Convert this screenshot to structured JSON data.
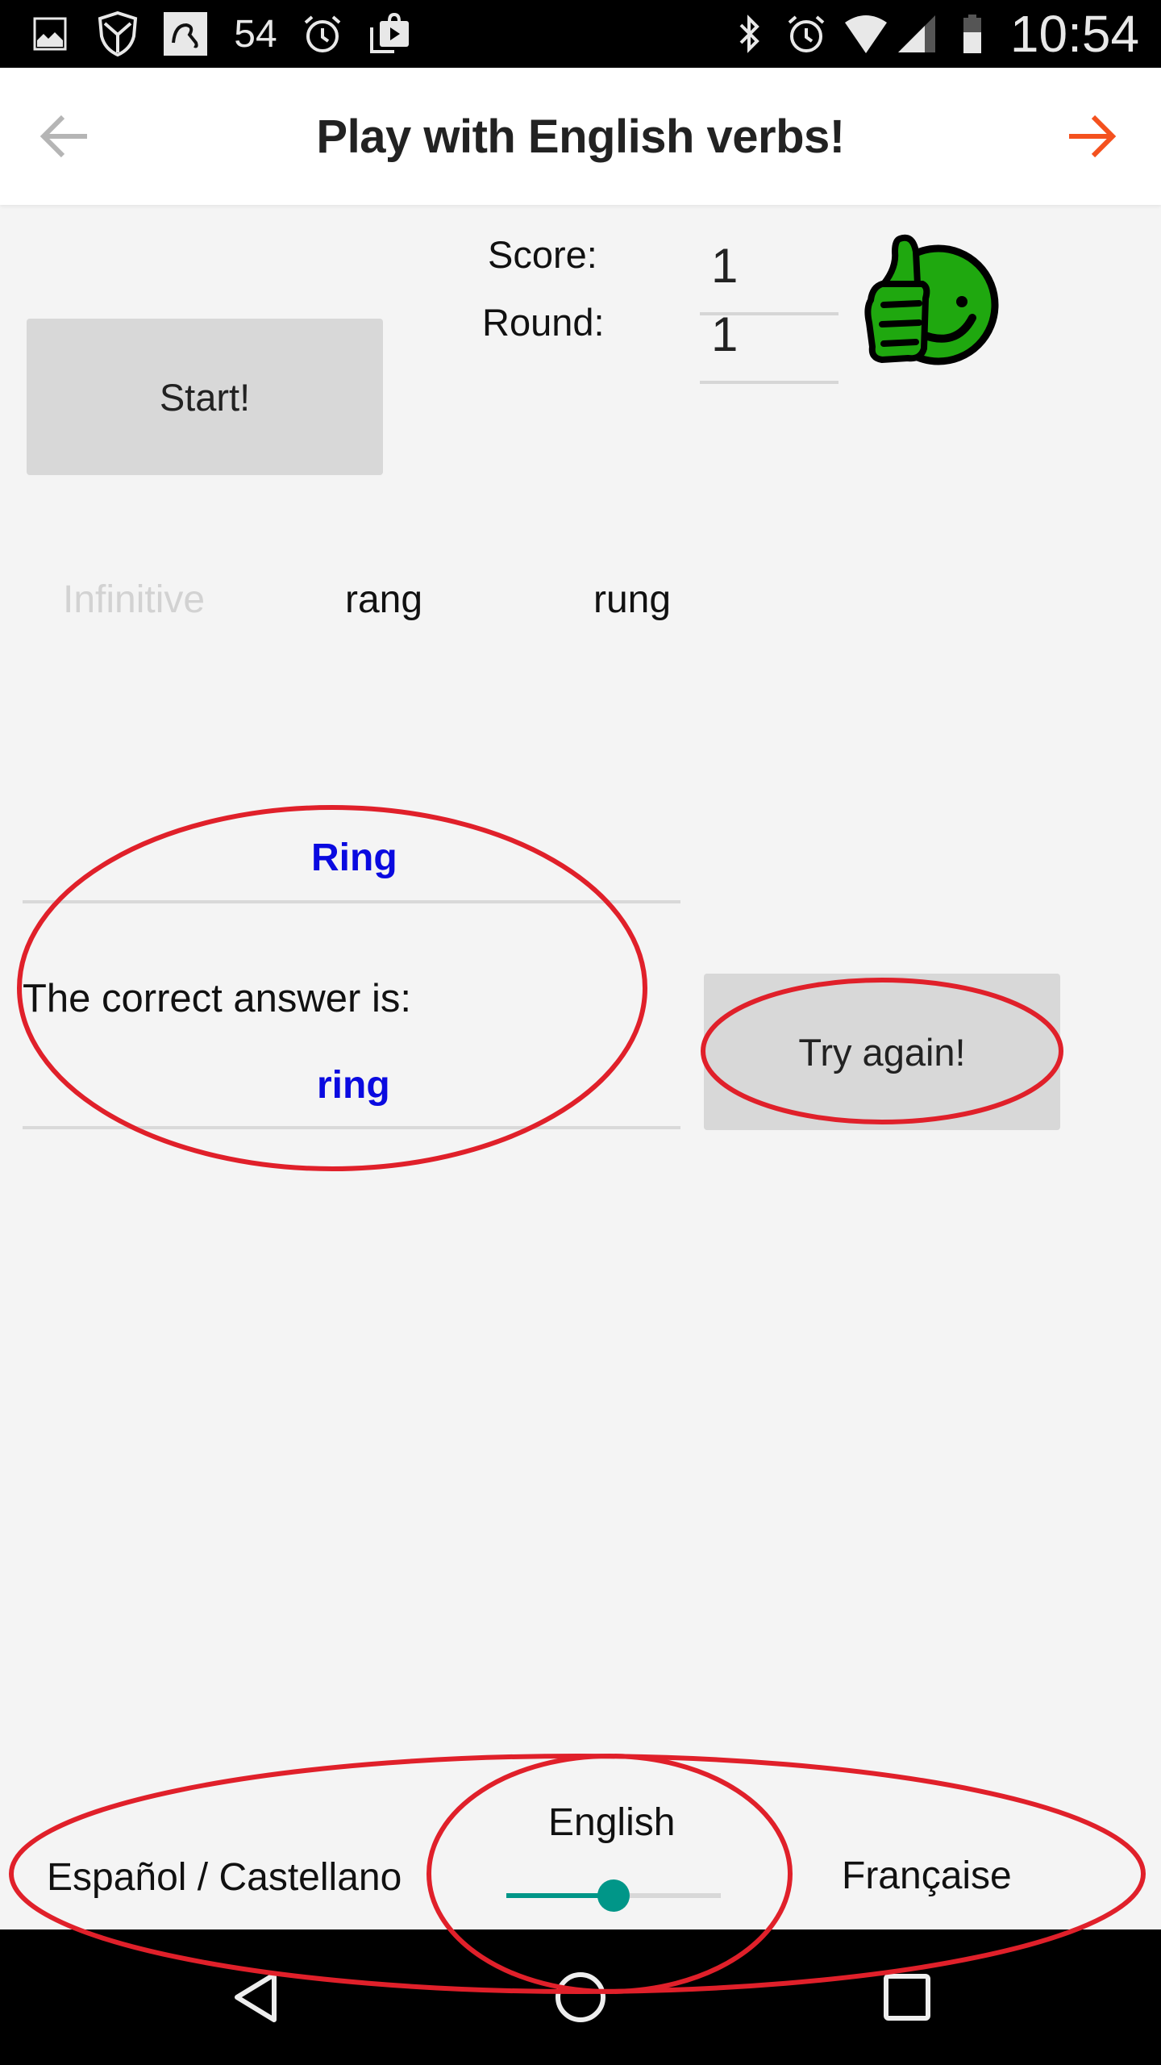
{
  "status_bar": {
    "left_icons": [
      "gallery-icon",
      "shield-icon",
      "avira-umbrella-icon",
      "notification-count",
      "alarm-icon",
      "play-store-icon"
    ],
    "notification_count": "54",
    "right_icons": [
      "bluetooth-icon",
      "alarm-icon",
      "wifi-icon",
      "cell-signal-icon",
      "battery-icon"
    ],
    "time": "10:54"
  },
  "app_bar": {
    "title": "Play with English verbs!",
    "back_icon": "arrow-left-icon",
    "forward_icon": "arrow-right-icon",
    "back_color": "#b5b5b5",
    "forward_color": "#f4511e"
  },
  "score_panel": {
    "score_label": "Score:",
    "score_value": "1",
    "round_label": "Round:",
    "round_value": "1",
    "feedback_icon": "thumbs-up-smiley-icon",
    "feedback_color": "#1fa80f"
  },
  "start_button": {
    "label": "Start!"
  },
  "verb_row": {
    "infinitive_placeholder": "Infinitive",
    "past_simple": "rang",
    "past_participle": "rung"
  },
  "answer": {
    "user_input": "Ring",
    "correct_label": "The correct answer is:",
    "correct_value": "ring",
    "answer_color": "#0a0ae0"
  },
  "try_again_button": {
    "label": "Try again!"
  },
  "language_selector": {
    "left_option": "Español / Castellano",
    "center_option": "English",
    "right_option": "Française",
    "selected": "English",
    "slider_position": 0.5,
    "accent_color": "#009688"
  },
  "nav_bar": {
    "buttons": [
      "back-triangle-icon",
      "home-circle-icon",
      "recents-square-icon"
    ]
  },
  "annotations": {
    "color": "#e0202a",
    "circled": [
      "answer-area",
      "try-again-button",
      "language-selector",
      "english-slider"
    ]
  }
}
